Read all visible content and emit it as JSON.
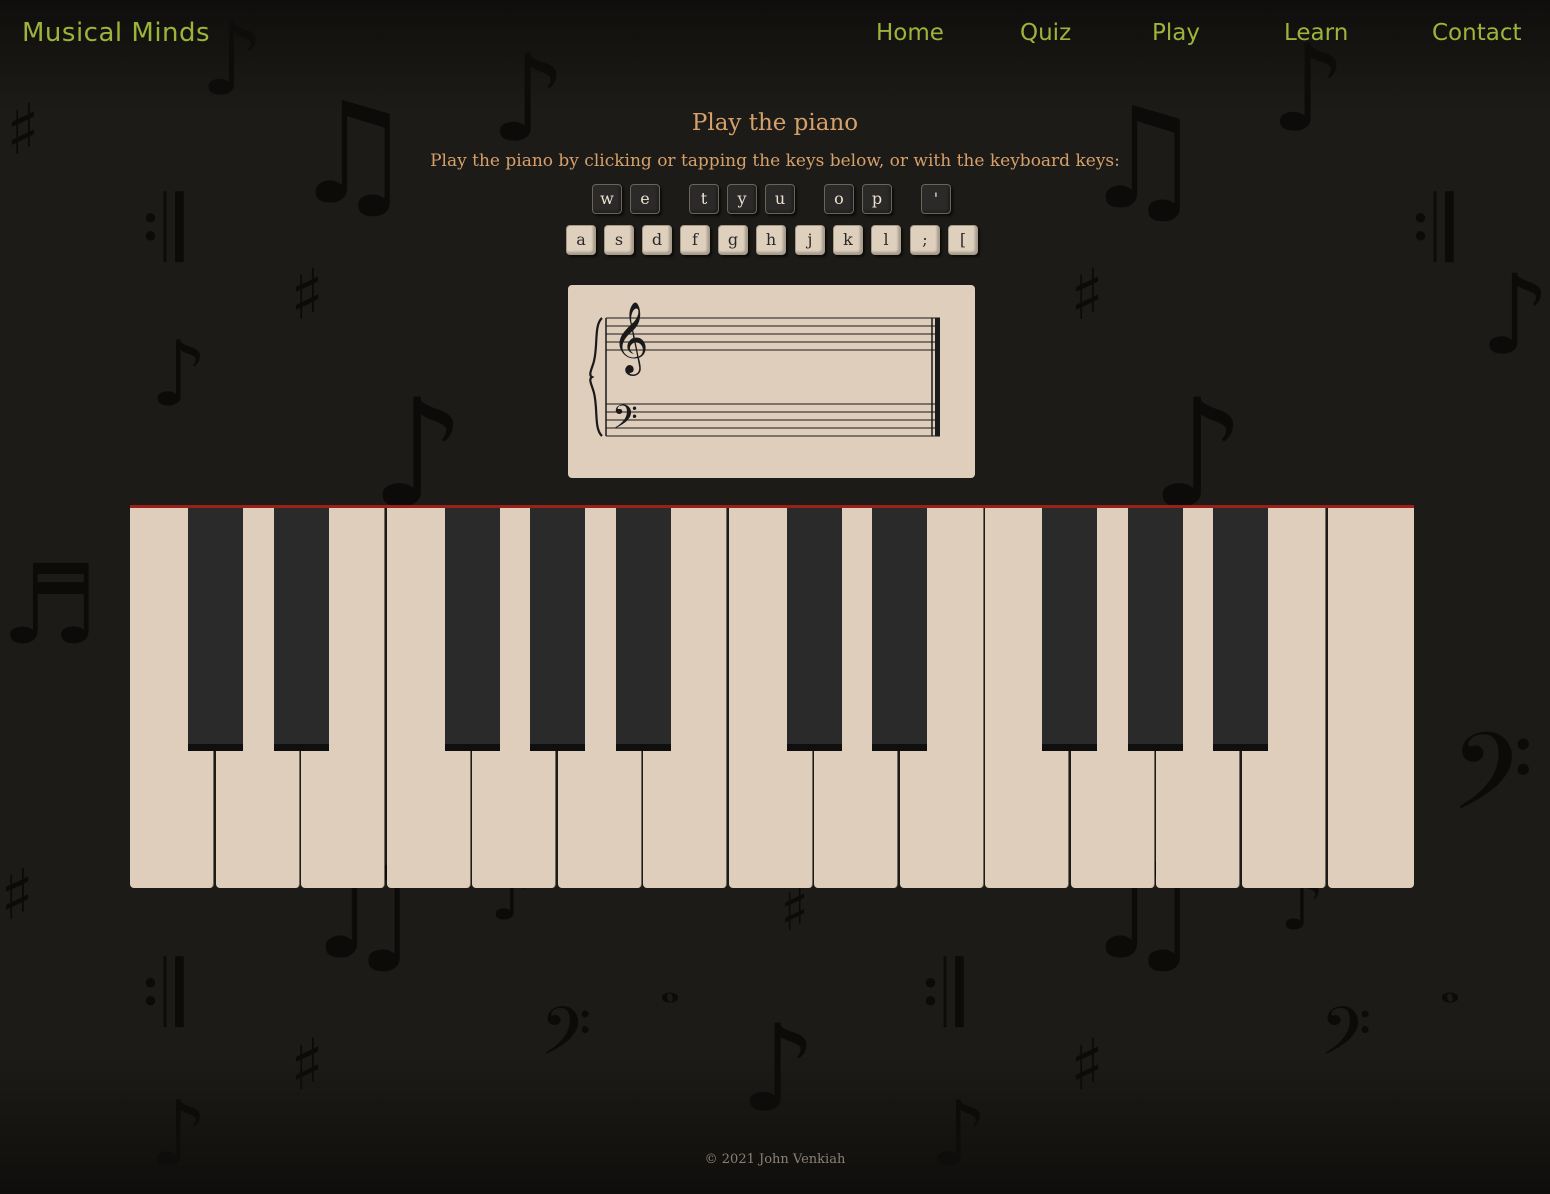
{
  "header": {
    "brand": "Musical Minds",
    "nav": [
      "Home",
      "Quiz",
      "Play",
      "Learn",
      "Contact"
    ]
  },
  "main": {
    "title": "Play the piano",
    "instructions": "Play the piano by clicking or tapping the keys below, or with the keyboard keys:",
    "black_key_hints": [
      "w",
      "e",
      "t",
      "y",
      "u",
      "o",
      "p",
      "'"
    ],
    "white_key_hints": [
      "a",
      "s",
      "d",
      "f",
      "g",
      "h",
      "j",
      "k",
      "l",
      ";",
      "["
    ]
  },
  "piano": {
    "white_keys": 15,
    "black_keys": 10
  },
  "footer": {
    "copyright": "© 2021 John Venkiah"
  },
  "colors": {
    "background": "#1d1b17",
    "nav_text": "#9cb43a",
    "heading_text": "#d6a06b",
    "ivory": "#decebb",
    "ebony": "#2a2a2a",
    "piano_accent": "#9a2018"
  }
}
